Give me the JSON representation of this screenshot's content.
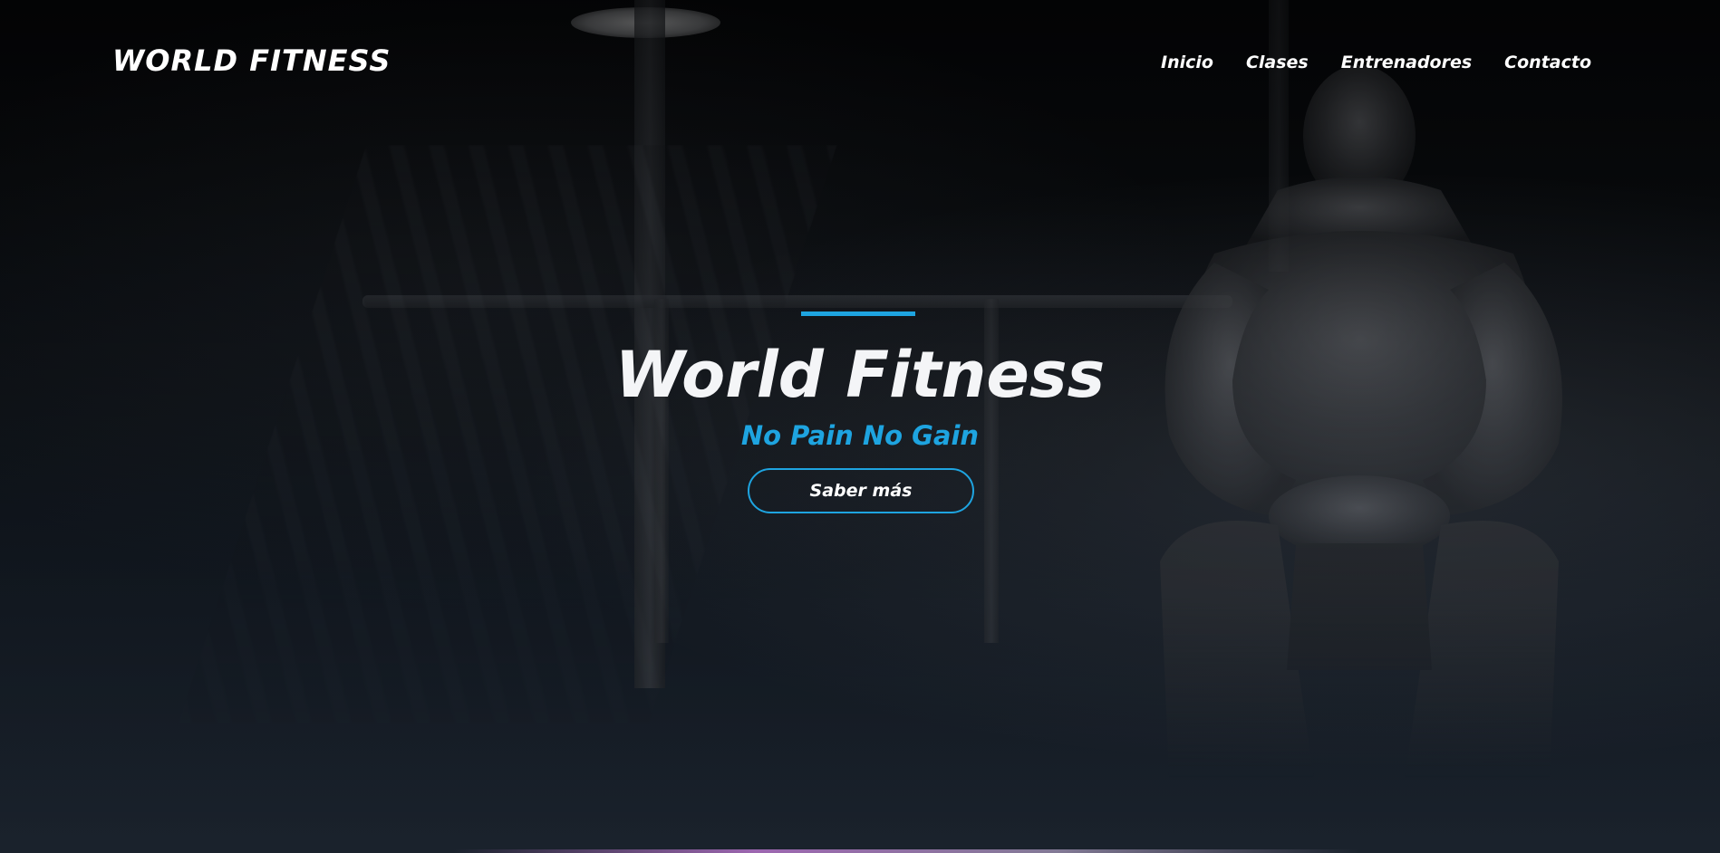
{
  "header": {
    "brand": "WORLD FITNESS",
    "nav": [
      {
        "label": "Inicio"
      },
      {
        "label": "Clases"
      },
      {
        "label": "Entrenadores"
      },
      {
        "label": "Contacto"
      }
    ]
  },
  "hero": {
    "title": "World Fitness",
    "subtitle": "No Pain No Gain",
    "cta_label": "Saber más"
  },
  "colors": {
    "accent": "#1ea4e0",
    "text": "#ffffff",
    "background_dark": "#07080a",
    "background_bottom": "#1a222c"
  }
}
